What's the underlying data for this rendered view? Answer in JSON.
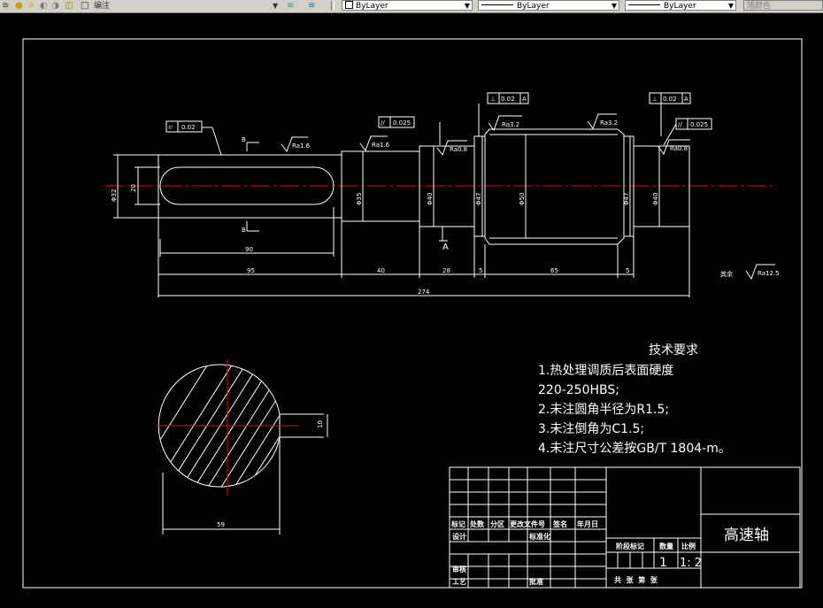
{
  "toolbar": {
    "layer_name": "编注",
    "layer_color_combo": "ByLayer",
    "linetype_combo": "ByLayer",
    "lineweight_combo": "ByLayer",
    "plot_style_combo": "随颜色",
    "icons": [
      "layer-manager-icon",
      "lightbulb-icon",
      "sun-icon",
      "lock-icon",
      "layer-color-icon",
      "make-current-icon",
      "layer-previous-icon"
    ]
  },
  "drawing": {
    "tolerance_boxes": {
      "left_top": {
        "symbol": "⌭",
        "value": "0.02"
      },
      "mid_parallel": {
        "symbol": "//",
        "value": "0.025"
      },
      "center_perp": {
        "symbol": "⊥",
        "value": "0.02",
        "datum": "A"
      },
      "right_perp": {
        "symbol": "⊥",
        "value": "0.02",
        "datum": "A"
      },
      "right_parallel": {
        "symbol": "//",
        "value": "0.025"
      }
    },
    "roughness": {
      "r1": "Ra1.6",
      "r2": "Ra1.6",
      "r3": "Ra0.8",
      "r4": "Ra3.2",
      "r5": "Ra3.2",
      "r6": "Ra0.8",
      "rest_label": "其余",
      "rest_value": "Ra12.5"
    },
    "section_marks": {
      "top": "B",
      "bottom": "B"
    },
    "datum_label": "A",
    "diameters": {
      "d1": "Φ32",
      "d1b": "20",
      "d2": "Φ35",
      "d3": "Φ40",
      "d4": "Φ47",
      "d5": "Φ50",
      "d6": "Φ47",
      "d7": "Φ40"
    },
    "dims": {
      "keyway_len": "90",
      "seg1": "95",
      "seg2": "40",
      "seg3": "28",
      "seg4": "5",
      "seg5": "65",
      "seg6": "5",
      "total": "274",
      "section_width": "59",
      "key_depth": "10"
    }
  },
  "notes": {
    "title": "技术要求",
    "items": [
      "1.热处理调质后表面硬度",
      "220-250HBS;",
      "2.未注圆角半径为R1.5;",
      "3.未注倒角为C1.5;",
      "4.未注尺寸公差按GB/T 1804-m。"
    ]
  },
  "title_block": {
    "part_name": "高速轴",
    "headers": [
      "标记",
      "处数",
      "分区",
      "更改文件号",
      "签名",
      "年月日"
    ],
    "design": "设计",
    "standardize": "标准化",
    "review": "审核",
    "process": "工艺",
    "approve": "批准",
    "stage_mark": "阶段标记",
    "quantity": "数量",
    "scale_label": "比例",
    "qty_value": "1",
    "scale_value": "1: 2",
    "sheets_line": "共  张  第  张"
  }
}
